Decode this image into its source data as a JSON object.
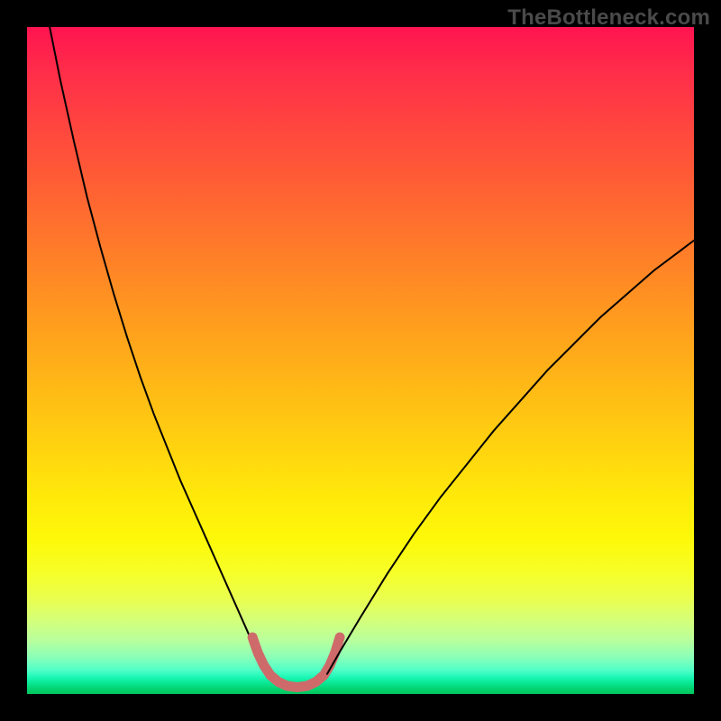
{
  "attribution": "TheBottleneck.com",
  "chart_data": {
    "type": "line",
    "title": "",
    "xlabel": "",
    "ylabel": "",
    "xlim": [
      0,
      100
    ],
    "ylim": [
      0,
      100
    ],
    "background_gradient": {
      "top_color": "#ff1450",
      "mid_color": "#ffe80a",
      "bottom_color": "#00c75d"
    },
    "series": [
      {
        "name": "left_branch",
        "stroke": "#000000",
        "stroke_width": 2,
        "x": [
          3.4,
          5.0,
          7.0,
          9.0,
          11.0,
          13.0,
          15.0,
          17.0,
          19.0,
          21.0,
          23.0,
          25.0,
          27.0,
          29.0,
          31.0,
          33.0,
          34.5,
          36.0
        ],
        "y": [
          100.0,
          92.0,
          83.0,
          74.5,
          67.0,
          60.0,
          53.5,
          47.5,
          42.0,
          37.0,
          32.0,
          27.5,
          23.0,
          18.5,
          14.0,
          9.5,
          6.0,
          3.0
        ]
      },
      {
        "name": "right_branch",
        "stroke": "#000000",
        "stroke_width": 2,
        "x": [
          45.0,
          47.0,
          50.0,
          54.0,
          58.0,
          62.0,
          66.0,
          70.0,
          74.0,
          78.0,
          82.0,
          86.0,
          90.0,
          94.0,
          98.0,
          100.0
        ],
        "y": [
          3.0,
          6.5,
          11.5,
          18.0,
          24.0,
          29.5,
          34.5,
          39.5,
          44.0,
          48.5,
          52.5,
          56.5,
          60.0,
          63.5,
          66.5,
          68.0
        ]
      },
      {
        "name": "valley_floor",
        "stroke": "#cf6a6a",
        "stroke_width": 11,
        "x": [
          33.8,
          34.6,
          35.5,
          36.5,
          37.7,
          39.0,
          40.5,
          42.0,
          43.3,
          44.5,
          45.4,
          46.2,
          46.9
        ],
        "y": [
          8.5,
          6.2,
          4.3,
          2.8,
          1.8,
          1.2,
          1.0,
          1.2,
          1.8,
          2.8,
          4.3,
          6.2,
          8.5
        ]
      }
    ]
  }
}
